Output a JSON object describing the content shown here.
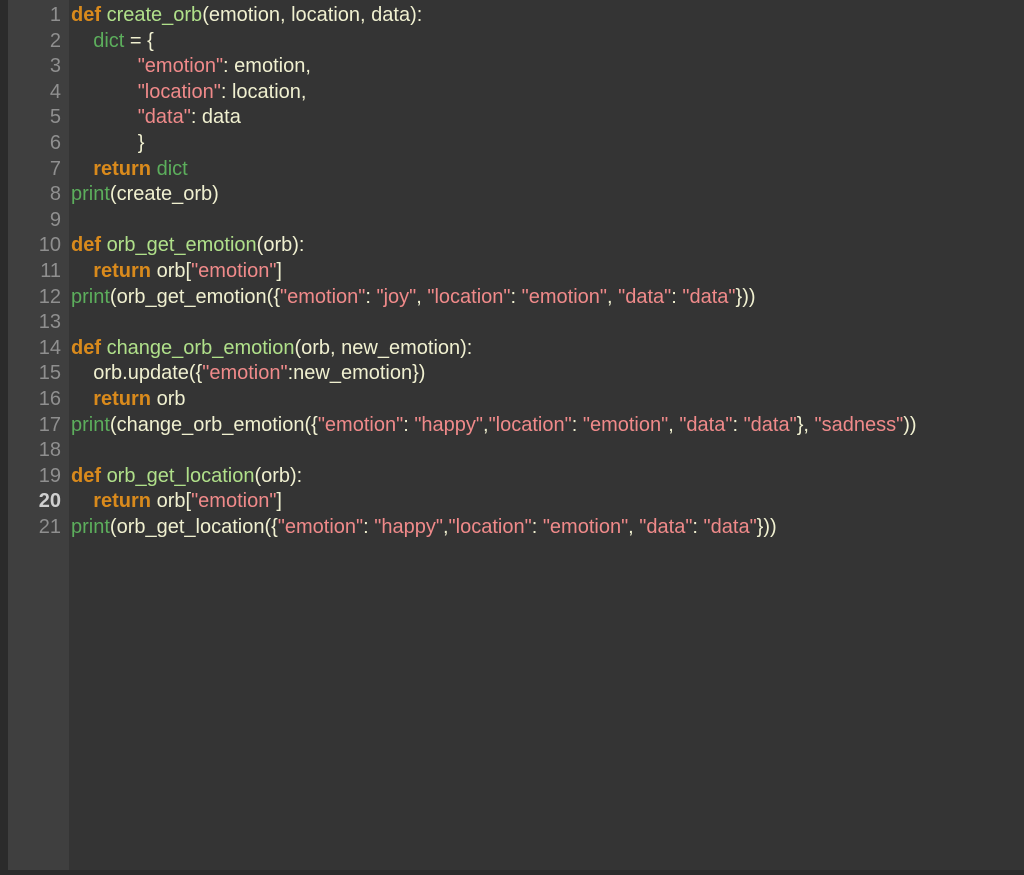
{
  "editor": {
    "active_line": 20,
    "colors": {
      "background": "#343434",
      "gutter": "#3f3f3f",
      "keyword": "#d98a1c",
      "function_name": "#b0e08a",
      "builtin": "#5cae5c",
      "string": "#f08a8a",
      "identifier": "#f0f0d0"
    },
    "lines": [
      {
        "number": "1",
        "indent": "",
        "tokens": [
          {
            "t": "def",
            "c": "kw"
          },
          {
            "t": " ",
            "c": "id"
          },
          {
            "t": "create_orb",
            "c": "fn"
          },
          {
            "t": "(emotion, location, data):",
            "c": "id"
          }
        ]
      },
      {
        "number": "2",
        "indent": "    ",
        "tokens": [
          {
            "t": "dict",
            "c": "bi"
          },
          {
            "t": " = {",
            "c": "id"
          }
        ]
      },
      {
        "number": "3",
        "indent": "            ",
        "tokens": [
          {
            "t": "\"emotion\"",
            "c": "str"
          },
          {
            "t": ": emotion,",
            "c": "id"
          }
        ]
      },
      {
        "number": "4",
        "indent": "            ",
        "tokens": [
          {
            "t": "\"location\"",
            "c": "str"
          },
          {
            "t": ": location,",
            "c": "id"
          }
        ]
      },
      {
        "number": "5",
        "indent": "            ",
        "tokens": [
          {
            "t": "\"data\"",
            "c": "str"
          },
          {
            "t": ": data",
            "c": "id"
          }
        ]
      },
      {
        "number": "6",
        "indent": "            ",
        "tokens": [
          {
            "t": "}",
            "c": "id"
          }
        ]
      },
      {
        "number": "7",
        "indent": "    ",
        "tokens": [
          {
            "t": "return",
            "c": "kw"
          },
          {
            "t": " ",
            "c": "id"
          },
          {
            "t": "dict",
            "c": "bi"
          }
        ]
      },
      {
        "number": "8",
        "indent": "",
        "tokens": [
          {
            "t": "print",
            "c": "bi"
          },
          {
            "t": "(create_orb)",
            "c": "id"
          }
        ]
      },
      {
        "number": "9",
        "indent": "",
        "tokens": []
      },
      {
        "number": "10",
        "indent": "",
        "tokens": [
          {
            "t": "def",
            "c": "kw"
          },
          {
            "t": " ",
            "c": "id"
          },
          {
            "t": "orb_get_emotion",
            "c": "fn"
          },
          {
            "t": "(orb):",
            "c": "id"
          }
        ]
      },
      {
        "number": "11",
        "indent": "    ",
        "tokens": [
          {
            "t": "return",
            "c": "kw"
          },
          {
            "t": " orb[",
            "c": "id"
          },
          {
            "t": "\"emotion\"",
            "c": "str"
          },
          {
            "t": "]",
            "c": "id"
          }
        ]
      },
      {
        "number": "12",
        "indent": "",
        "tokens": [
          {
            "t": "print",
            "c": "bi"
          },
          {
            "t": "(orb_get_emotion({",
            "c": "id"
          },
          {
            "t": "\"emotion\"",
            "c": "str"
          },
          {
            "t": ": ",
            "c": "id"
          },
          {
            "t": "\"joy\"",
            "c": "str"
          },
          {
            "t": ", ",
            "c": "id"
          },
          {
            "t": "\"location\"",
            "c": "str"
          },
          {
            "t": ": ",
            "c": "id"
          },
          {
            "t": "\"emotion\"",
            "c": "str"
          },
          {
            "t": ", ",
            "c": "id"
          },
          {
            "t": "\"data\"",
            "c": "str"
          },
          {
            "t": ": ",
            "c": "id"
          },
          {
            "t": "\"data\"",
            "c": "str"
          },
          {
            "t": "}))",
            "c": "id"
          }
        ]
      },
      {
        "number": "13",
        "indent": "",
        "tokens": []
      },
      {
        "number": "14",
        "indent": "",
        "tokens": [
          {
            "t": "def",
            "c": "kw"
          },
          {
            "t": " ",
            "c": "id"
          },
          {
            "t": "change_orb_emotion",
            "c": "fn"
          },
          {
            "t": "(orb, new_emotion):",
            "c": "id"
          }
        ]
      },
      {
        "number": "15",
        "indent": "    ",
        "tokens": [
          {
            "t": "orb.update({",
            "c": "id"
          },
          {
            "t": "\"emotion\"",
            "c": "str"
          },
          {
            "t": ":new_emotion})",
            "c": "id"
          }
        ]
      },
      {
        "number": "16",
        "indent": "    ",
        "tokens": [
          {
            "t": "return",
            "c": "kw"
          },
          {
            "t": " orb",
            "c": "id"
          }
        ]
      },
      {
        "number": "17",
        "indent": "",
        "tokens": [
          {
            "t": "print",
            "c": "bi"
          },
          {
            "t": "(change_orb_emotion({",
            "c": "id"
          },
          {
            "t": "\"emotion\"",
            "c": "str"
          },
          {
            "t": ": ",
            "c": "id"
          },
          {
            "t": "\"happy\"",
            "c": "str"
          },
          {
            "t": ",",
            "c": "id"
          },
          {
            "t": "\"location\"",
            "c": "str"
          },
          {
            "t": ": ",
            "c": "id"
          },
          {
            "t": "\"emotion\"",
            "c": "str"
          },
          {
            "t": ", ",
            "c": "id"
          },
          {
            "t": "\"data\"",
            "c": "str"
          },
          {
            "t": ": ",
            "c": "id"
          },
          {
            "t": "\"data\"",
            "c": "str"
          },
          {
            "t": "}, ",
            "c": "id"
          },
          {
            "t": "\"sadness\"",
            "c": "str"
          },
          {
            "t": "))",
            "c": "id"
          }
        ]
      },
      {
        "number": "18",
        "indent": "",
        "tokens": []
      },
      {
        "number": "19",
        "indent": "",
        "tokens": [
          {
            "t": "def",
            "c": "kw"
          },
          {
            "t": " ",
            "c": "id"
          },
          {
            "t": "orb_get_location",
            "c": "fn"
          },
          {
            "t": "(orb):",
            "c": "id"
          }
        ]
      },
      {
        "number": "20",
        "indent": "    ",
        "tokens": [
          {
            "t": "return",
            "c": "kw"
          },
          {
            "t": " orb[",
            "c": "id"
          },
          {
            "t": "\"emotion\"",
            "c": "str"
          },
          {
            "t": "]",
            "c": "id"
          }
        ]
      },
      {
        "number": "21",
        "indent": "",
        "tokens": [
          {
            "t": "print",
            "c": "bi"
          },
          {
            "t": "(orb_get_location({",
            "c": "id"
          },
          {
            "t": "\"emotion\"",
            "c": "str"
          },
          {
            "t": ": ",
            "c": "id"
          },
          {
            "t": "\"happy\"",
            "c": "str"
          },
          {
            "t": ",",
            "c": "id"
          },
          {
            "t": "\"location\"",
            "c": "str"
          },
          {
            "t": ": ",
            "c": "id"
          },
          {
            "t": "\"emotion\"",
            "c": "str"
          },
          {
            "t": ", ",
            "c": "id"
          },
          {
            "t": "\"data\"",
            "c": "str"
          },
          {
            "t": ": ",
            "c": "id"
          },
          {
            "t": "\"data\"",
            "c": "str"
          },
          {
            "t": "}))",
            "c": "id"
          }
        ]
      }
    ]
  }
}
